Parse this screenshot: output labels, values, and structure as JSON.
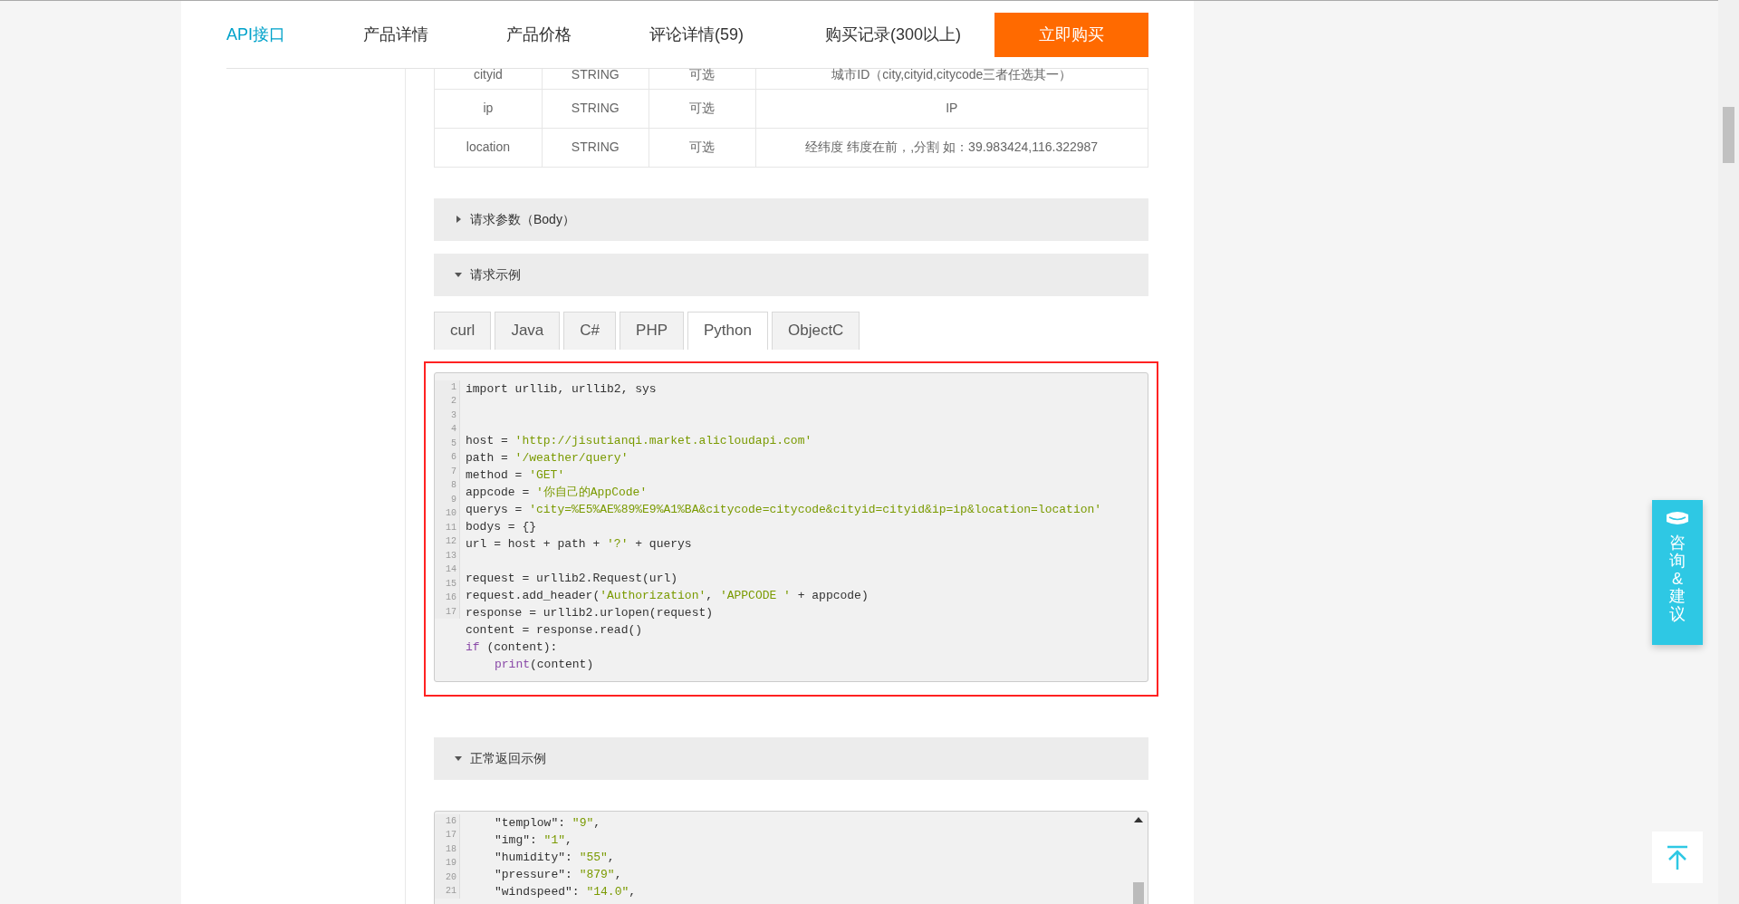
{
  "nav": {
    "tabs": [
      {
        "label": "API接口",
        "selected": true
      },
      {
        "label": "产品详情",
        "selected": false
      },
      {
        "label": "产品价格",
        "selected": false
      },
      {
        "label": "评论详情(59)",
        "selected": false
      },
      {
        "label": "购买记录(300以上)",
        "selected": false
      }
    ],
    "buy_button": "立即购买"
  },
  "params_table": {
    "rows": [
      [
        "cityid",
        "STRING",
        "可选",
        "城市ID（city,cityid,citycode三者任选其一）"
      ],
      [
        "ip",
        "STRING",
        "可选",
        "IP"
      ],
      [
        "location",
        "STRING",
        "可选",
        "经纬度 纬度在前，,分割 如：39.983424,116.322987"
      ]
    ]
  },
  "body_section": {
    "title": "请求参数（Body）",
    "expanded": false
  },
  "example_section": {
    "title": "请求示例",
    "expanded": true,
    "tabs": [
      {
        "label": "curl",
        "selected": false
      },
      {
        "label": "Java",
        "selected": false
      },
      {
        "label": "C#",
        "selected": false
      },
      {
        "label": "PHP",
        "selected": false
      },
      {
        "label": "Python",
        "selected": true
      },
      {
        "label": "ObjectC",
        "selected": false
      }
    ],
    "code": {
      "line_numbers": [
        "1",
        "2",
        "3",
        "4",
        "5",
        "6",
        "7",
        "8",
        "9",
        "10",
        "11",
        "12",
        "13",
        "14",
        "15",
        "16",
        "17"
      ],
      "lines": [
        {
          "kind": "code",
          "segments": [
            {
              "kind": "plain",
              "text": "import urllib, urllib2, sys"
            }
          ]
        },
        {
          "kind": "blank"
        },
        {
          "kind": "blank"
        },
        {
          "kind": "code",
          "segments": [
            {
              "kind": "plain",
              "text": "host = "
            },
            {
              "kind": "string",
              "text": "'http://jisutianqi.market.alicloudapi.com'"
            }
          ]
        },
        {
          "kind": "code",
          "segments": [
            {
              "kind": "plain",
              "text": "path = "
            },
            {
              "kind": "string",
              "text": "'/weather/query'"
            }
          ]
        },
        {
          "kind": "code",
          "segments": [
            {
              "kind": "plain",
              "text": "method = "
            },
            {
              "kind": "string",
              "text": "'GET'"
            }
          ]
        },
        {
          "kind": "code",
          "segments": [
            {
              "kind": "plain",
              "text": "appcode = "
            },
            {
              "kind": "string",
              "text": "'你自己的AppCode'"
            }
          ]
        },
        {
          "kind": "code",
          "segments": [
            {
              "kind": "plain",
              "text": "querys = "
            },
            {
              "kind": "string",
              "text": "'city=%E5%AE%89%E9%A1%BA&citycode=citycode&cityid=cityid&ip=ip&location=location'"
            }
          ]
        },
        {
          "kind": "code",
          "segments": [
            {
              "kind": "plain",
              "text": "bodys = {}"
            }
          ]
        },
        {
          "kind": "code",
          "segments": [
            {
              "kind": "plain",
              "text": "url = host + path + "
            },
            {
              "kind": "string",
              "text": "'?'"
            },
            {
              "kind": "plain",
              "text": " + querys"
            }
          ]
        },
        {
          "kind": "blank"
        },
        {
          "kind": "code",
          "segments": [
            {
              "kind": "plain",
              "text": "request = urllib2.Request(url)"
            }
          ]
        },
        {
          "kind": "code",
          "segments": [
            {
              "kind": "plain",
              "text": "request.add_header("
            },
            {
              "kind": "string",
              "text": "'Authorization'"
            },
            {
              "kind": "plain",
              "text": ", "
            },
            {
              "kind": "string",
              "text": "'APPCODE '"
            },
            {
              "kind": "plain",
              "text": " + appcode)"
            }
          ]
        },
        {
          "kind": "code",
          "segments": [
            {
              "kind": "plain",
              "text": "response = urllib2.urlopen(request)"
            }
          ]
        },
        {
          "kind": "code",
          "segments": [
            {
              "kind": "plain",
              "text": "content = response.read()"
            }
          ]
        },
        {
          "kind": "code",
          "segments": [
            {
              "kind": "keyword",
              "text": "if"
            },
            {
              "kind": "plain",
              "text": " (content):"
            }
          ]
        },
        {
          "kind": "code",
          "indent": true,
          "segments": [
            {
              "kind": "keyword",
              "text": "print"
            },
            {
              "kind": "plain",
              "text": "(content)"
            }
          ]
        }
      ]
    }
  },
  "response_section": {
    "title": "正常返回示例",
    "expanded": true,
    "code": {
      "line_numbers": [
        "16",
        "17",
        "18",
        "19",
        "20",
        "21"
      ],
      "lines": [
        {
          "kind": "code",
          "indent": true,
          "segments": [
            {
              "kind": "plain",
              "text": "\"templow\": "
            },
            {
              "kind": "string",
              "text": "\"9\""
            },
            {
              "kind": "plain",
              "text": ","
            }
          ]
        },
        {
          "kind": "code",
          "indent": true,
          "segments": [
            {
              "kind": "plain",
              "text": "\"img\": "
            },
            {
              "kind": "string",
              "text": "\"1\""
            },
            {
              "kind": "plain",
              "text": ","
            }
          ]
        },
        {
          "kind": "code",
          "indent": true,
          "segments": [
            {
              "kind": "plain",
              "text": "\"humidity\": "
            },
            {
              "kind": "string",
              "text": "\"55\""
            },
            {
              "kind": "plain",
              "text": ","
            }
          ]
        },
        {
          "kind": "code",
          "indent": true,
          "segments": [
            {
              "kind": "plain",
              "text": "\"pressure\": "
            },
            {
              "kind": "string",
              "text": "\"879\""
            },
            {
              "kind": "plain",
              "text": ","
            }
          ]
        },
        {
          "kind": "code",
          "indent": true,
          "segments": [
            {
              "kind": "plain",
              "text": "\"windspeed\": "
            },
            {
              "kind": "string",
              "text": "\"14.0\""
            },
            {
              "kind": "plain",
              "text": ","
            }
          ]
        }
      ]
    }
  },
  "side_widget": {
    "label": "咨询&建议"
  }
}
